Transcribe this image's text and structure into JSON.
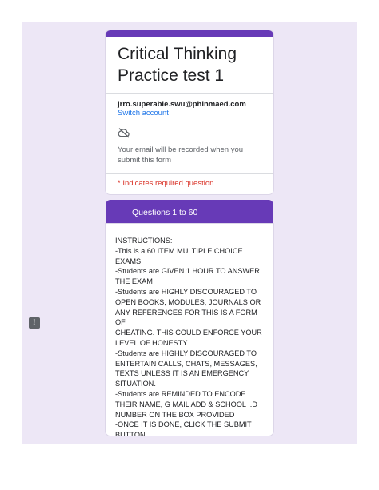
{
  "form": {
    "title_line1": "Critical Thinking",
    "title_line2": "Practice test 1",
    "account_email": "jrro.superable.swu@phinmaed.com",
    "switch_account_label": "Switch account",
    "record_notice": "Your email will be recorded when you submit this form",
    "required_note": "* Indicates required question"
  },
  "section": {
    "header": "Questions 1 to 60",
    "instructions": [
      "INSTRUCTIONS:",
      "-This is a 60 ITEM MULTIPLE CHOICE",
      "EXAMS",
      "-Students are GIVEN 1 HOUR TO ANSWER",
      "THE EXAM",
      "-Students are HIGHLY DISCOURAGED TO",
      "OPEN BOOKS, MODULES, JOURNALS OR",
      "ANY REFERENCES FOR THIS IS A FORM OF",
      "CHEATING. THIS COULD ENFORCE YOUR",
      "LEVEL OF HONESTY.",
      "-Students are HIGHLY DISCOURAGED TO",
      "ENTERTAIN CALLS, CHATS, MESSAGES,",
      "TEXTS UNLESS IT IS AN EMERGENCY",
      "SITUATION.",
      "-Students are REMINDED TO ENCODE",
      "THEIR NAME, G MAIL ADD & SCHOOL I.D",
      "NUMBER ON THE BOX PROVIDED",
      "-ONCE IT IS DONE, CLICK THE SUBMIT",
      "BUTTON"
    ]
  },
  "icons": {
    "cloud": "cloud-off-icon",
    "feedback": "feedback-icon"
  },
  "colors": {
    "accent": "#673ab7",
    "background": "#ede7f6",
    "link": "#1a73e8",
    "required": "#d93025"
  }
}
